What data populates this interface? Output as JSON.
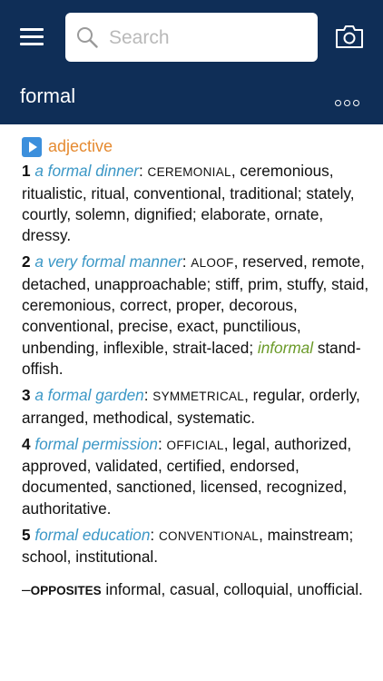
{
  "header": {
    "search_placeholder": "Search",
    "headword": "formal"
  },
  "entry": {
    "part_of_speech": "adjective",
    "senses": [
      {
        "number": "1",
        "example": "a formal dinner",
        "keyword": "CEREMONIAL",
        "synonyms": ", ceremonious, ritualistic, ritual, conventional, traditional; stately, courtly, solemn, dignified; elaborate, ornate, dressy."
      },
      {
        "number": "2",
        "example": "a very formal manner",
        "keyword": "ALOOF",
        "synonyms": ", reserved, remote, detached, unapproachable; stiff, prim, stuffy, staid, ceremonious, correct, proper, decorous, conventional, precise, exact, punctilious, unbending, inflexible, strait-laced;",
        "register": "informal",
        "register_synonyms": "stand-offish."
      },
      {
        "number": "3",
        "example": "a formal garden",
        "keyword": "SYMMETRICAL",
        "synonyms": ", regular, orderly, arranged, methodical, systematic."
      },
      {
        "number": "4",
        "example": "formal permission",
        "keyword": "OFFICIAL",
        "synonyms": ", legal, authorized, approved, validated, certified, endorsed, documented, sanctioned, licensed, recognized, authoritative."
      },
      {
        "number": "5",
        "example": "formal education",
        "keyword": "CONVENTIONAL",
        "synonyms": ", mainstream; school, institutional."
      }
    ],
    "opposites_label": "OPPOSITES",
    "opposites": "informal, casual, colloquial, unofficial."
  }
}
